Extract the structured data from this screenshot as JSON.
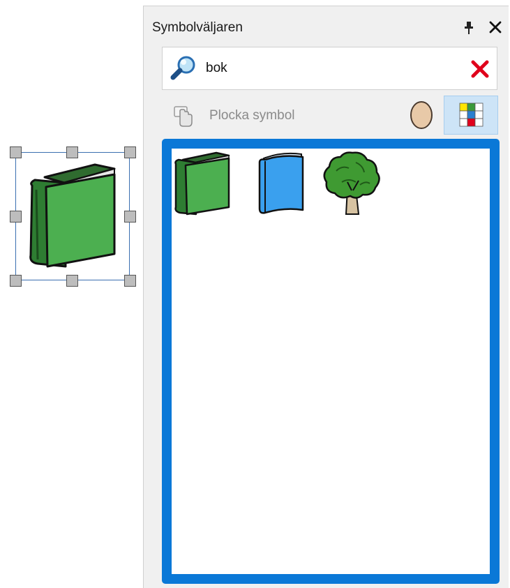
{
  "canvas": {
    "selected_symbol_icon": "book-green-icon"
  },
  "panel": {
    "title": "Symbolväljaren",
    "pin_icon": "pin-icon",
    "close_icon": "close-icon"
  },
  "search": {
    "value": "bok",
    "search_icon": "magnifier-icon",
    "clear_icon": "clear-x-icon"
  },
  "toolbar": {
    "pick_label": "Plocka symbol",
    "pick_icon": "hand-pointer-icon",
    "skin_icon": "skin-tone-icon",
    "color_icon": "color-grid-icon"
  },
  "results": {
    "items": [
      {
        "icon": "book-green-icon"
      },
      {
        "icon": "book-blue-icon"
      },
      {
        "icon": "tree-icon"
      }
    ]
  },
  "colors": {
    "accent": "#0a78d7",
    "clear": "#e0001b",
    "selection_border": "#3a6fb0"
  }
}
